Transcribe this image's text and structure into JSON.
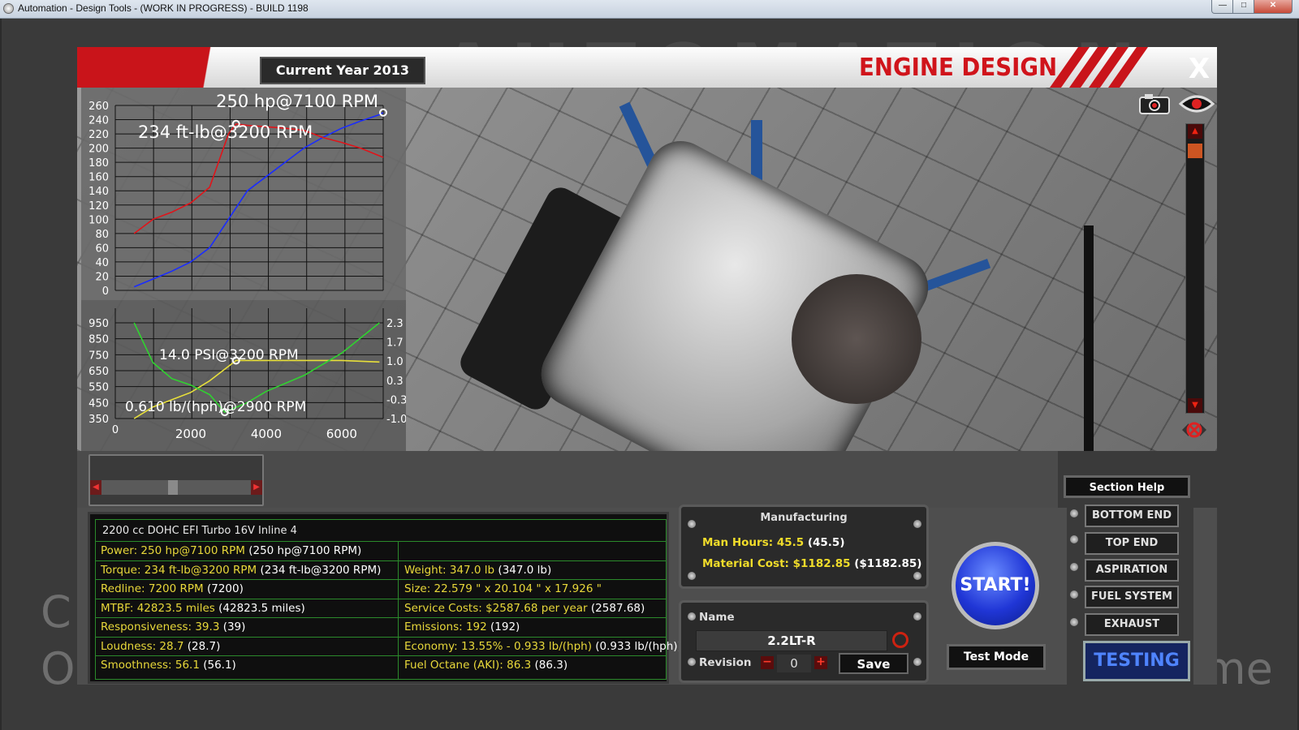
{
  "window": {
    "title": "Automation - Design Tools - (WORK IN PROGRESS) - BUILD 1198",
    "min_label": "—",
    "max_label": "□",
    "close_label": "✕"
  },
  "background": {
    "brand": "AUTOMATION",
    "left_top": "C",
    "left_bottom": "O",
    "right_bottom": "me"
  },
  "header": {
    "year": "Current Year 2013",
    "title": "ENGINE DESIGN",
    "close": "X"
  },
  "chart_data": [
    {
      "type": "line",
      "title": "",
      "ylim": [
        0,
        260
      ],
      "yticks": [
        "260",
        "240",
        "220",
        "200",
        "180",
        "160",
        "140",
        "120",
        "100",
        "80",
        "60",
        "40",
        "20",
        "0"
      ],
      "annotations": [
        "250 hp@7100 RPM",
        "234 ft-lb@3200 RPM"
      ],
      "series": [
        {
          "color": "#1a2cff",
          "x": [
            500,
            1000,
            1500,
            2000,
            2500,
            3000,
            3500,
            4000,
            4500,
            5000,
            5500,
            6000,
            6500,
            7000,
            7100
          ],
          "y": [
            5,
            16,
            27,
            40,
            60,
            100,
            140,
            160,
            180,
            200,
            215,
            228,
            238,
            247,
            250
          ]
        },
        {
          "color": "#e0141a",
          "x": [
            500,
            1000,
            1500,
            2000,
            2500,
            3000,
            3200,
            3500,
            4000,
            4500,
            5000,
            5500,
            6000,
            6500,
            7100
          ],
          "y": [
            80,
            100,
            110,
            123,
            145,
            220,
            234,
            232,
            230,
            228,
            225,
            215,
            208,
            200,
            187
          ]
        }
      ]
    },
    {
      "type": "line",
      "title": "",
      "xlim": [
        0,
        7100
      ],
      "xticks": [
        "0",
        "2000",
        "4000",
        "6000"
      ],
      "yticks_left": [
        "950",
        "850",
        "750",
        "650",
        "550",
        "450",
        "350"
      ],
      "yticks_right": [
        "2.3",
        "1.7",
        "1.0",
        "0.3",
        "-0.3",
        "-1.0"
      ],
      "annotations": [
        "14.0 PSI@3200 RPM",
        "0.610 lb/(hph)@2900 RPM"
      ],
      "series": [
        {
          "color": "#e8e03a",
          "x": [
            500,
            1000,
            1500,
            2000,
            2500,
            3000,
            3200,
            4000,
            5000,
            6000,
            7000
          ],
          "y": [
            -1.0,
            -0.6,
            -0.35,
            -0.1,
            0.3,
            0.8,
            1.0,
            1.0,
            1.0,
            1.0,
            0.95
          ]
        },
        {
          "color": "#2fd42f",
          "x": [
            500,
            1000,
            1500,
            2000,
            2500,
            2900,
            3500,
            4000,
            5000,
            6000,
            7000
          ],
          "y": [
            950,
            700,
            600,
            560,
            500,
            390,
            450,
            520,
            620,
            760,
            950
          ]
        }
      ]
    }
  ],
  "stats": {
    "header": "2200 cc DOHC EFI Turbo 16V Inline 4",
    "rows": [
      {
        "a_label": "Power: 250 hp@7100 RPM",
        "a_val": " (250 hp@7100 RPM)",
        "b_label": "",
        "b_val": ""
      },
      {
        "a_label": "Torque: 234 ft-lb@3200 RPM",
        "a_val": " (234 ft-lb@3200 RPM)",
        "b_label": "Weight: 347.0 lb",
        "b_val": " (347.0 lb)"
      },
      {
        "a_label": "Redline: 7200 RPM",
        "a_val": " (7200)",
        "b_label": "Size: 22.579 \" x 20.104 \" x 17.926 \"",
        "b_val": ""
      },
      {
        "a_label": "MTBF: 42823.5 miles",
        "a_val": " (42823.5 miles)",
        "b_label": "Service Costs: $2587.68 per year",
        "b_val": " (2587.68)"
      },
      {
        "a_label": "Responsiveness: 39.3",
        "a_val": " (39)",
        "b_label": "Emissions: 192",
        "b_val": " (192)"
      },
      {
        "a_label": "Loudness: 28.7",
        "a_val": " (28.7)",
        "b_label": "Economy: 13.55% - 0.933 lb/(hph)",
        "b_val": " (0.933 lb/(hph))"
      },
      {
        "a_label": "Smoothness: 56.1",
        "a_val": " (56.1)",
        "b_label": "Fuel Octane (AKI): 86.3",
        "b_val": " (86.3)"
      }
    ]
  },
  "manufacturing": {
    "title": "Manufacturing",
    "man_hours_label": "Man Hours: 45.5",
    "man_hours_val": " (45.5)",
    "material_label": "Material Cost: $1182.85",
    "material_val": " ($1182.85)"
  },
  "naming": {
    "name_label": "Name",
    "name_value": "2.2LT-R",
    "revision_label": "Revision",
    "revision_value": "0",
    "minus": "−",
    "plus": "+",
    "save": "Save"
  },
  "controls": {
    "start": "START!",
    "test_mode": "Test Mode",
    "section_help": "Section Help"
  },
  "nav": {
    "items": [
      "BOTTOM END",
      "TOP END",
      "ASPIRATION",
      "FUEL SYSTEM",
      "EXHAUST",
      "TESTING"
    ],
    "active": "TESTING"
  },
  "colors": {
    "accent_red": "#c9141a",
    "power_blue": "#1a2cff",
    "torque_red": "#e0141a",
    "boost_yellow": "#e8e03a",
    "bsfc_green": "#2fd42f",
    "stat_yellow": "#e8d83a"
  },
  "icons": [
    "camera-icon",
    "eye-icon",
    "scroll-up-icon",
    "scroll-down-icon",
    "reset-view-icon",
    "refresh-icon"
  ]
}
